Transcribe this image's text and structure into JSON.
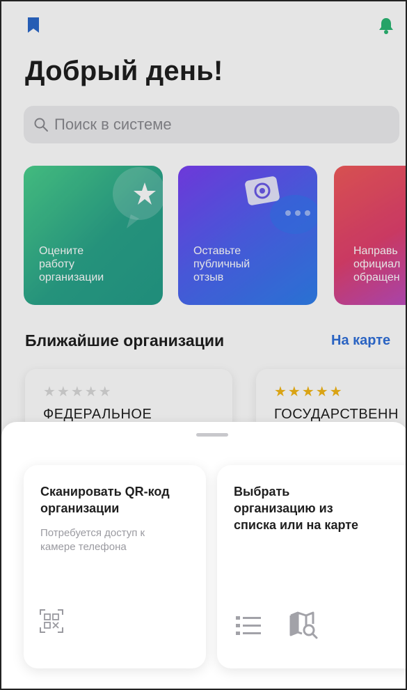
{
  "header": {
    "greeting": "Добрый день!",
    "bookmark_icon": "bookmark-icon",
    "bell_icon": "bell-icon"
  },
  "search": {
    "placeholder": "Поиск в системе",
    "icon": "search-icon"
  },
  "action_cards": [
    {
      "label": "Оцените\nработу\nорганизации",
      "icon": "star-chat-icon"
    },
    {
      "label": "Оставьте\nпубличный\nотзыв",
      "icon": "camera-chat-icon"
    },
    {
      "label": "Направь\nофициал\nобращен"
    }
  ],
  "nearby": {
    "title": "Ближайшие организации",
    "map_link": "На карте",
    "organizations": [
      {
        "rating_stars": "★★★★★",
        "rating": 0,
        "name": "ФЕДЕРАЛЬНОЕ"
      },
      {
        "rating_stars": "★★★★★",
        "rating": 5,
        "name": "ГОСУДАРСТВЕНН"
      }
    ]
  },
  "sheet": {
    "options": [
      {
        "title": "Сканировать QR-код\nорганизации",
        "subtitle": "Потребуется доступ к\nкамере телефона",
        "icon": "qr-code-icon"
      },
      {
        "title": "Выбрать\nорганизацию из\nсписка или на карте",
        "icons": [
          "list-icon",
          "map-search-icon"
        ]
      }
    ]
  },
  "colors": {
    "accent": "#2f6fd8",
    "bookmark": "#2b68c9",
    "bell": "#2bb673",
    "star_active": "#f2b617"
  }
}
